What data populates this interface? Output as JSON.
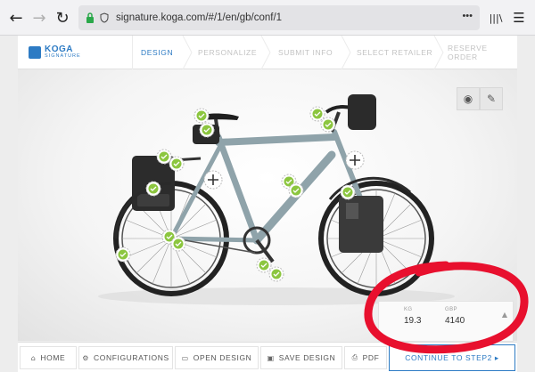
{
  "browser": {
    "url": "signature.koga.com/#/1/en/gb/conf/1",
    "menu_dots": "•••",
    "library_icon": "|||\\",
    "menu_icon": "☰"
  },
  "header": {
    "logo_main": "KOGA",
    "logo_sub": "SIGNATURE",
    "steps": [
      {
        "label": "DESIGN",
        "active": true
      },
      {
        "label": "PERSONALIZE",
        "active": false
      },
      {
        "label": "SUBMIT INFO",
        "active": false
      },
      {
        "label": "SELECT RETAILER",
        "active": false
      },
      {
        "label": "RESERVE ORDER",
        "active": false
      }
    ]
  },
  "price": {
    "weight_label": "KG",
    "weight_value": "19.3",
    "currency_label": "GBP",
    "price_value": "4140"
  },
  "toolbar": {
    "home": "HOME",
    "configurations": "CONFIGURATIONS",
    "open_design": "OPEN DESIGN",
    "save_design": "SAVE DESIGN",
    "pdf": "PDF",
    "continue": "CONTINUE TO STEP2 ▸"
  },
  "colors": {
    "brand": "#2d7bc4",
    "frame": "#8fa3aa",
    "check": "#8cc63f",
    "annotation": "#e8102e"
  }
}
